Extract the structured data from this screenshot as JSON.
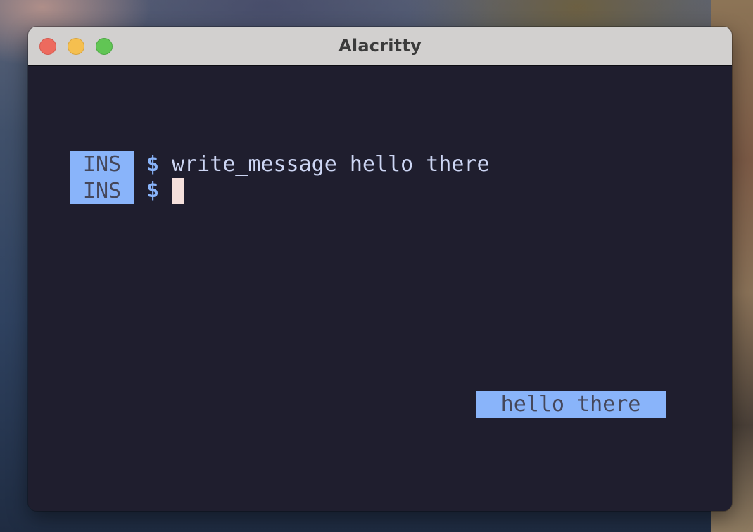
{
  "window": {
    "title": "Alacritty",
    "controls": {
      "close": "close",
      "minimize": "minimize",
      "zoom": "zoom"
    }
  },
  "terminal": {
    "lines": [
      {
        "mode": "INS",
        "prompt": "$",
        "command": "write_message hello there"
      },
      {
        "mode": "INS",
        "prompt": "$",
        "command": ""
      }
    ],
    "message_box": {
      "text": "hello there"
    }
  },
  "colors": {
    "terminal_background": "#1f1e2e",
    "mode_badge_background": "#89b4fa",
    "mode_badge_text": "#45475a",
    "prompt": "#89b4fa",
    "command_text": "#cdd6f4",
    "cursor": "#f5e0dc",
    "titlebar": "#d2d0cf",
    "close": "#ed6a5e",
    "minimize": "#f5bf4f",
    "zoom": "#61c554"
  }
}
